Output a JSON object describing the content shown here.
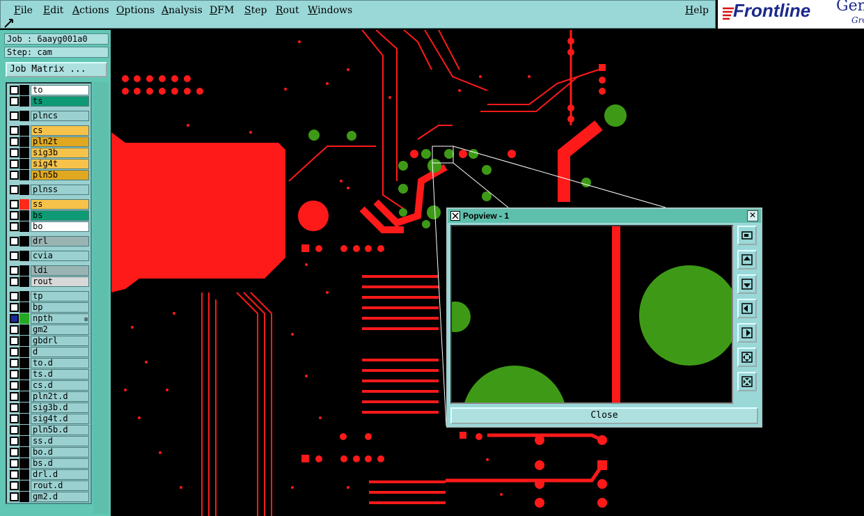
{
  "menu": {
    "items": [
      {
        "label": "File"
      },
      {
        "label": "Edit"
      },
      {
        "label": "Actions"
      },
      {
        "label": "Options"
      },
      {
        "label": "Analysis"
      },
      {
        "label": "DFM"
      },
      {
        "label": "Step"
      },
      {
        "label": "Rout"
      },
      {
        "label": "Windows"
      }
    ],
    "help_label": "Help"
  },
  "logo": {
    "brand": "Frontline",
    "product": "Gen",
    "tagline": "Gro",
    "color": "#1b2a8a",
    "accent": "#d81010"
  },
  "job": {
    "job_label": "Job : 6aayg001a0",
    "step_label": "Step: cam",
    "matrix_button": "Job Matrix ..."
  },
  "layers": [
    {
      "name": "to",
      "bg": "#ffffff",
      "swatch": "#000000"
    },
    {
      "name": "ts",
      "bg": "#0e9a74",
      "swatch": "#000000"
    },
    {
      "name": "plncs",
      "bg": "#9ad0d0",
      "swatch": "#000000"
    },
    {
      "name": "cs",
      "bg": "#f6c24a",
      "swatch": "#000000"
    },
    {
      "name": "pln2t",
      "bg": "#e0a820",
      "swatch": "#000000"
    },
    {
      "name": "sig3b",
      "bg": "#f6c24a",
      "swatch": "#000000"
    },
    {
      "name": "sig4t",
      "bg": "#f6c24a",
      "swatch": "#000000"
    },
    {
      "name": "pln5b",
      "bg": "#e0a820",
      "swatch": "#000000"
    },
    {
      "name": "plnss",
      "bg": "#9ad0d0",
      "swatch": "#000000"
    },
    {
      "name": "ss",
      "bg": "#f6c24a",
      "swatch": "#ff2a1a"
    },
    {
      "name": "bs",
      "bg": "#0e9a74",
      "swatch": "#000000"
    },
    {
      "name": "bo",
      "bg": "#ffffff",
      "swatch": "#000000"
    },
    {
      "name": "drl",
      "bg": "#9ab4b4",
      "swatch": "#000000"
    },
    {
      "name": "cvia",
      "bg": "#9ad0d0",
      "swatch": "#000000"
    },
    {
      "name": "ldi",
      "bg": "#9ab4b4",
      "swatch": "#000000"
    },
    {
      "name": "rout",
      "bg": "#d8d8d8",
      "swatch": "#000000"
    },
    {
      "name": "tp",
      "bg": "#9ad0d0",
      "swatch": "#000000"
    },
    {
      "name": "bp",
      "bg": "#9ad0d0",
      "swatch": "#000000"
    },
    {
      "name": "npth",
      "bg": "#9ad0d0",
      "swatch": "#22a822",
      "active": true
    },
    {
      "name": "gm2",
      "bg": "#9ad0d0",
      "swatch": "#000000"
    },
    {
      "name": "gbdrl",
      "bg": "#9ad0d0",
      "swatch": "#000000"
    },
    {
      "name": "d",
      "bg": "#9ad0d0",
      "swatch": "#000000"
    },
    {
      "name": "to.d",
      "bg": "#9ad0d0",
      "swatch": "#000000"
    },
    {
      "name": "ts.d",
      "bg": "#9ad0d0",
      "swatch": "#000000"
    },
    {
      "name": "cs.d",
      "bg": "#9ad0d0",
      "swatch": "#000000"
    },
    {
      "name": "pln2t.d",
      "bg": "#9ad0d0",
      "swatch": "#000000"
    },
    {
      "name": "sig3b.d",
      "bg": "#9ad0d0",
      "swatch": "#000000"
    },
    {
      "name": "sig4t.d",
      "bg": "#9ad0d0",
      "swatch": "#000000"
    },
    {
      "name": "pln5b.d",
      "bg": "#9ad0d0",
      "swatch": "#000000"
    },
    {
      "name": "ss.d",
      "bg": "#9ad0d0",
      "swatch": "#000000"
    },
    {
      "name": "bo.d",
      "bg": "#9ad0d0",
      "swatch": "#000000"
    },
    {
      "name": "bs.d",
      "bg": "#9ad0d0",
      "swatch": "#000000"
    },
    {
      "name": "drl.d",
      "bg": "#9ad0d0",
      "swatch": "#000000"
    },
    {
      "name": "rout.d",
      "bg": "#9ad0d0",
      "swatch": "#000000"
    },
    {
      "name": "gm2.d",
      "bg": "#9ad0d0",
      "swatch": "#000000"
    }
  ],
  "popview": {
    "title": "Popview - 1",
    "close_label": "Close",
    "tools": [
      "zoom-window-icon",
      "pan-up-icon",
      "pan-down-icon",
      "pan-left-icon",
      "pan-right-icon",
      "zoom-out-icon",
      "zoom-in-icon"
    ]
  },
  "colors": {
    "copper": "#ff1a1a",
    "drill": "#3e9a16",
    "ui_bg": "#9ad8d8",
    "panel_bg": "#62c6b4"
  }
}
